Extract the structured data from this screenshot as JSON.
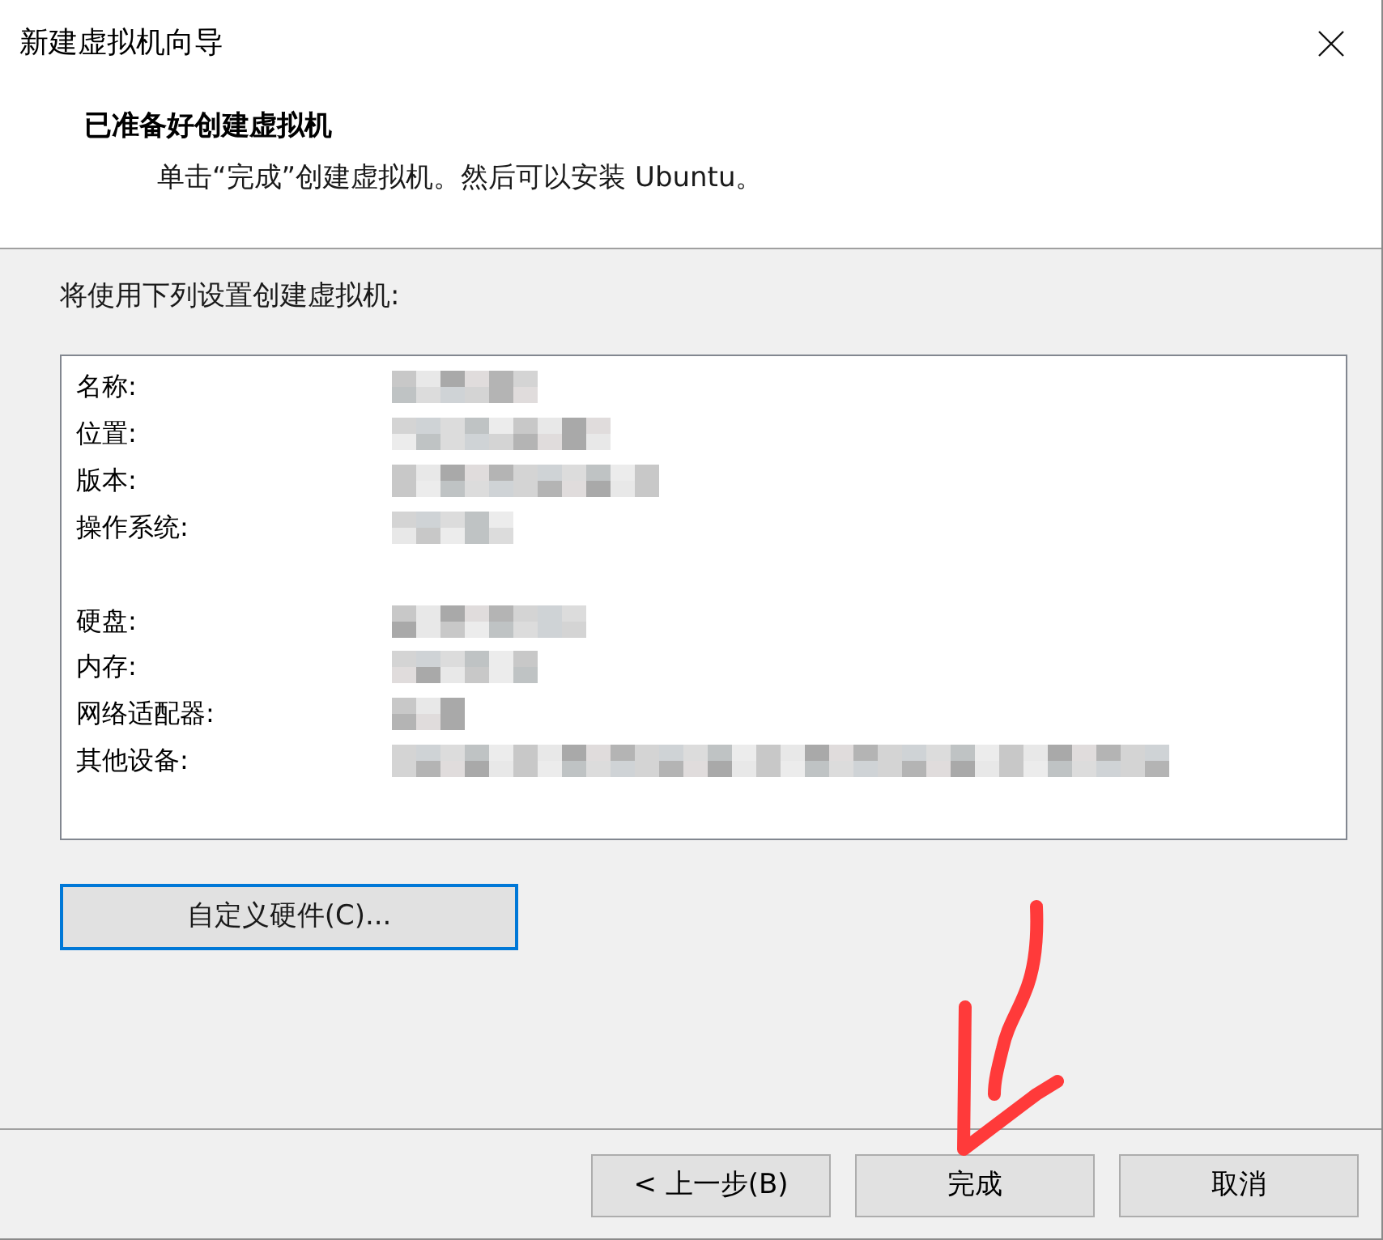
{
  "window": {
    "title": "新建虚拟机向导"
  },
  "header": {
    "title": "已准备好创建虚拟机",
    "subtitle": "单击“完成”创建虚拟机。然后可以安装 Ubuntu。"
  },
  "intro": "将使用下列设置创建虚拟机:",
  "settings": [
    {
      "rows": [
        {
          "label": "名称:",
          "redacted": true
        },
        {
          "label": "位置:",
          "redacted": true
        },
        {
          "label": "版本:",
          "redacted": true
        },
        {
          "label": "操作系统:",
          "redacted": true
        }
      ]
    },
    {
      "rows": [
        {
          "label": "硬盘:",
          "redacted": true
        },
        {
          "label": "内存:",
          "redacted": true
        },
        {
          "label": "网络适配器:",
          "redacted": true
        },
        {
          "label": "其他设备:",
          "redacted": true
        }
      ]
    }
  ],
  "customize_button": {
    "label": "自定义硬件(C)...",
    "focused": true
  },
  "buttons": [
    {
      "label": "< 上一步(B)",
      "focused": false
    },
    {
      "label": "完成",
      "focused": false
    },
    {
      "label": "取消",
      "focused": false
    }
  ]
}
